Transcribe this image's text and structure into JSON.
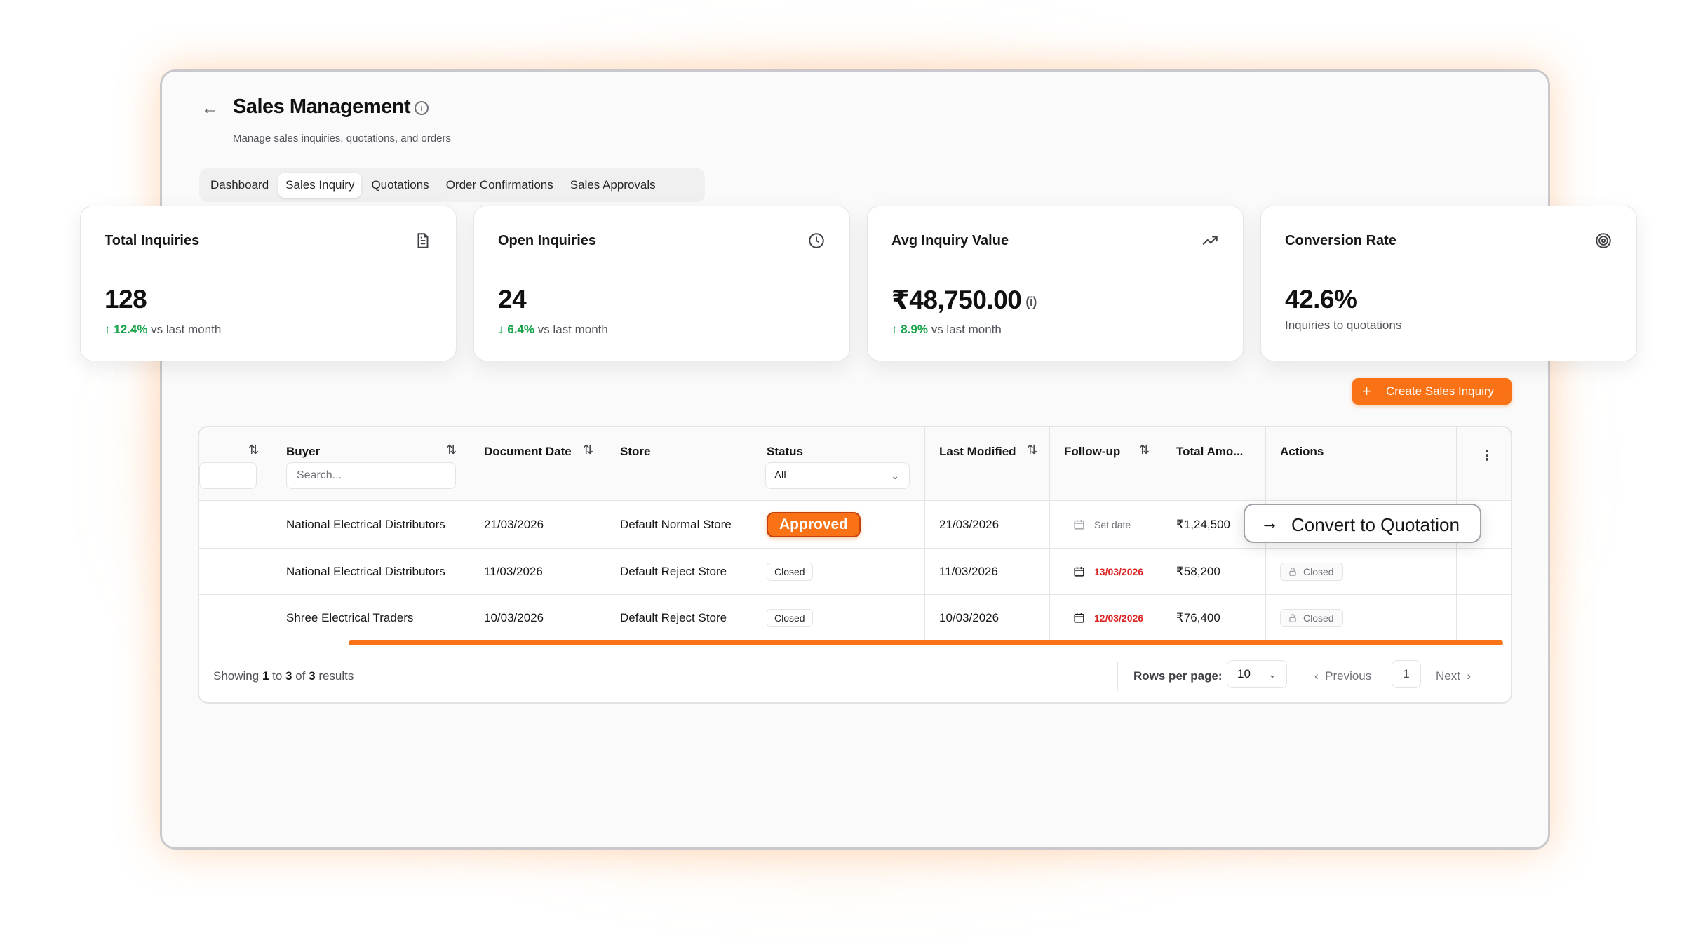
{
  "header": {
    "back_icon": "arrow-left-icon",
    "title": "Sales Management",
    "subtitle": "Manage sales inquiries, quotations, and orders"
  },
  "tabs": [
    {
      "label": "Dashboard",
      "active": false
    },
    {
      "label": "Sales Inquiry",
      "active": true
    },
    {
      "label": "Quotations",
      "active": false
    },
    {
      "label": "Order Confirmations",
      "active": false
    },
    {
      "label": "Sales Approvals",
      "active": false
    }
  ],
  "stats": [
    {
      "title": "Total Inquiries",
      "icon": "document-icon",
      "value": "128",
      "trend_arrow": "↑",
      "trend_value": "12.4%",
      "trend_text": " vs last month"
    },
    {
      "title": "Open Inquiries",
      "icon": "clock-icon",
      "value": "24",
      "trend_arrow": "↓",
      "trend_value": "6.4%",
      "trend_text": " vs last month"
    },
    {
      "title": "Avg Inquiry Value",
      "icon": "trending-up-icon",
      "value": "₹48,750.00",
      "value_info": "(i)",
      "trend_arrow": "↑",
      "trend_value": "8.9%",
      "trend_text": " vs last month"
    },
    {
      "title": "Conversion Rate",
      "icon": "target-icon",
      "value": "42.6%",
      "note": "Inquiries to quotations"
    }
  ],
  "actions": {
    "create_label": "Create Sales Inquiry"
  },
  "table": {
    "columns": {
      "buyer": "Buyer",
      "document_date": "Document Date",
      "store": "Store",
      "status": "Status",
      "last_modified": "Last Modified",
      "follow_up": "Follow-up",
      "total_amount": "Total Amo...",
      "actions": "Actions"
    },
    "buyer_search_placeholder": "Search...",
    "status_filter_value": "All",
    "rows": [
      {
        "buyer": "National Electrical Distributors",
        "document_date": "21/03/2026",
        "store": "Default Normal Store",
        "status": "Approved",
        "last_modified": "21/03/2026",
        "follow_up": "Set date",
        "total_amount": "₹1,24,500",
        "action": "Convert to Quotation"
      },
      {
        "buyer": "National Electrical Distributors",
        "document_date": "11/03/2026",
        "store": "Default Reject Store",
        "status": "Closed",
        "last_modified": "11/03/2026",
        "follow_up": "13/03/2026",
        "total_amount": "₹58,200",
        "action": "Closed"
      },
      {
        "buyer": "Shree Electrical Traders",
        "document_date": "10/03/2026",
        "store": "Default Reject Store",
        "status": "Closed",
        "last_modified": "10/03/2026",
        "follow_up": "12/03/2026",
        "total_amount": "₹76,400",
        "action": "Closed"
      }
    ]
  },
  "footer": {
    "showing_prefix": "Showing ",
    "showing_from": "1",
    "showing_to_word": " to ",
    "showing_to": "3",
    "showing_of_word": " of ",
    "showing_total": "3",
    "showing_suffix": " results",
    "rows_per_page_label": "Rows per page:",
    "rows_per_page_value": "10",
    "previous_label": "Previous",
    "current_page": "1",
    "next_label": "Next"
  },
  "colors": {
    "accent": "#f97316",
    "trend_positive": "#16a34a",
    "overdue": "#dc2626"
  }
}
